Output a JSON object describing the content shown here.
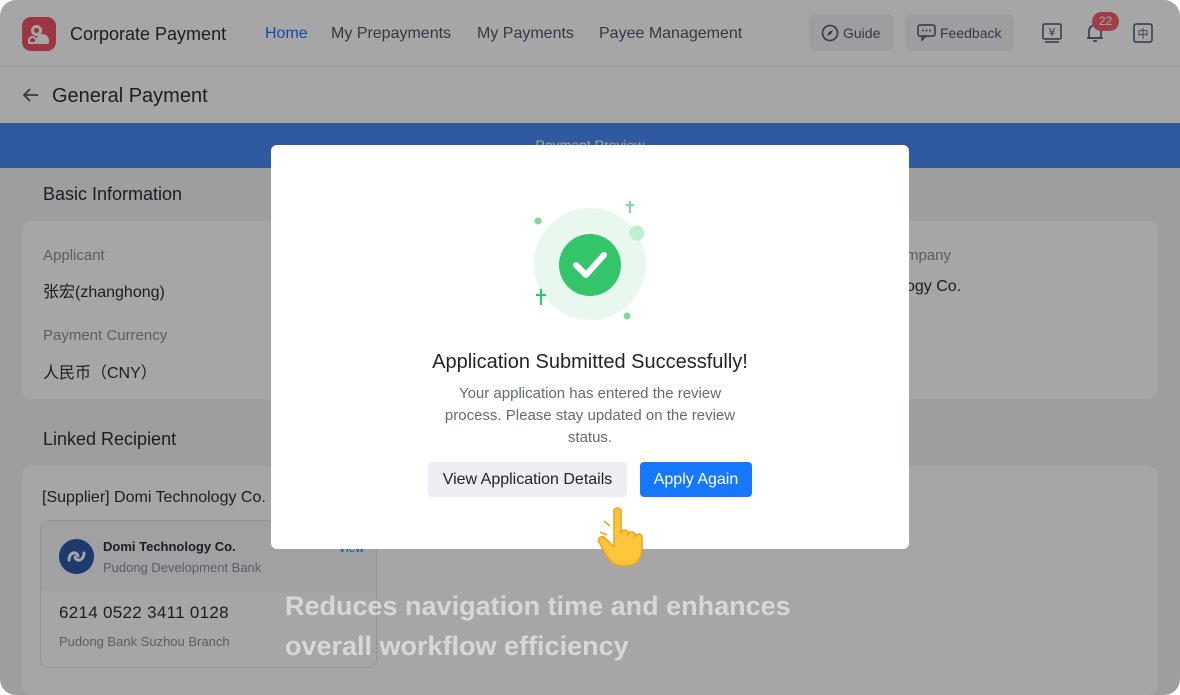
{
  "app": {
    "title": "Corporate Payment",
    "nav": [
      "Home",
      "My Prepayments",
      "My Payments",
      "Payee Management"
    ],
    "active_nav": "Home",
    "guide_label": "Guide",
    "feedback_label": "Feedback",
    "notification_count": "22",
    "currency_icon": "yen-icon",
    "language_icon": "zh-language-icon"
  },
  "page": {
    "title": "General Payment",
    "step_label": "Payment Preview"
  },
  "basic_info": {
    "section_title": "Basic Information",
    "applicant_label": "Applicant",
    "applicant_value": "张宏(zhanghong)",
    "company_label_fragment": "mpany",
    "company_value_fragment": "ogy Co.",
    "currency_label": "Payment Currency",
    "currency_value": "人民币（CNY）"
  },
  "linked_recipient": {
    "section_title": "Linked Recipient",
    "recipient": "[Supplier] Domi Technology Co.",
    "bank_card": {
      "name": "Domi Technology Co.",
      "bank": "Pudong Development Bank",
      "view_label": "View",
      "account_number": "6214 0522 3411 0128",
      "branch": "Pudong Bank Suzhou Branch"
    }
  },
  "modal": {
    "title": "Application Submitted Successfully!",
    "description": "Your application has entered the review process. Please stay updated on the review status.",
    "secondary_button": "View Application Details",
    "primary_button": "Apply Again"
  },
  "caption": {
    "line1": "Reduces navigation time and enhances",
    "line2": "overall workflow efficiency"
  },
  "colors": {
    "accent": "#1677ff",
    "brand": "#f05467",
    "success": "#34c46a"
  }
}
